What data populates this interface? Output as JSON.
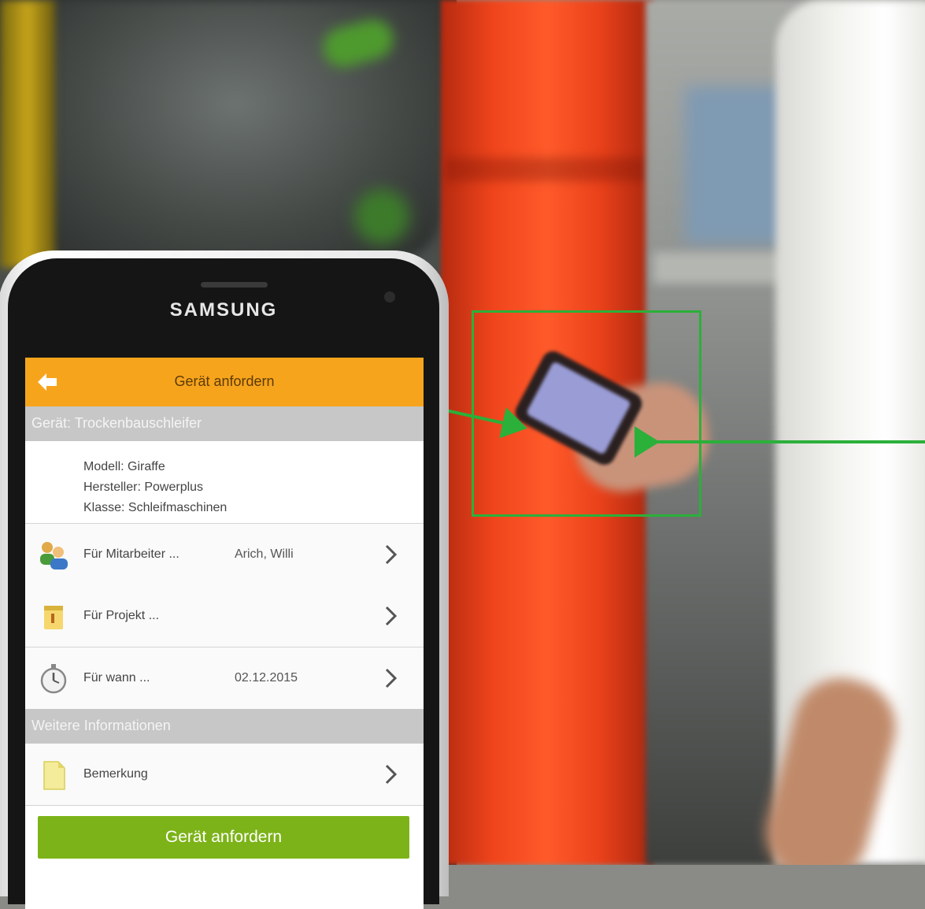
{
  "phone": {
    "brand": "SAMSUNG"
  },
  "app": {
    "title": "Gerät anfordern",
    "accent_color": "#f7a41d",
    "button_color": "#7cb318"
  },
  "device_section": {
    "header": "Gerät: Trockenbauschleifer",
    "details": [
      "Modell: Giraffe",
      "Hersteller: Powerplus",
      "Klasse: Schleifmaschinen"
    ]
  },
  "rows": [
    {
      "icon": "employees-icon",
      "label": "Für Mitarbeiter ...",
      "value": "Arich, Willi"
    },
    {
      "icon": "project-icon",
      "label": "Für Projekt ...",
      "value": ""
    },
    {
      "icon": "stopwatch-icon",
      "label": "Für wann ...",
      "value": "02.12.2015"
    }
  ],
  "more_section": {
    "header": "Weitere Informationen",
    "remark_label": "Bemerkung"
  },
  "submit_label": "Gerät anfordern",
  "overlay": {
    "highlight_color": "#2bb03a"
  }
}
